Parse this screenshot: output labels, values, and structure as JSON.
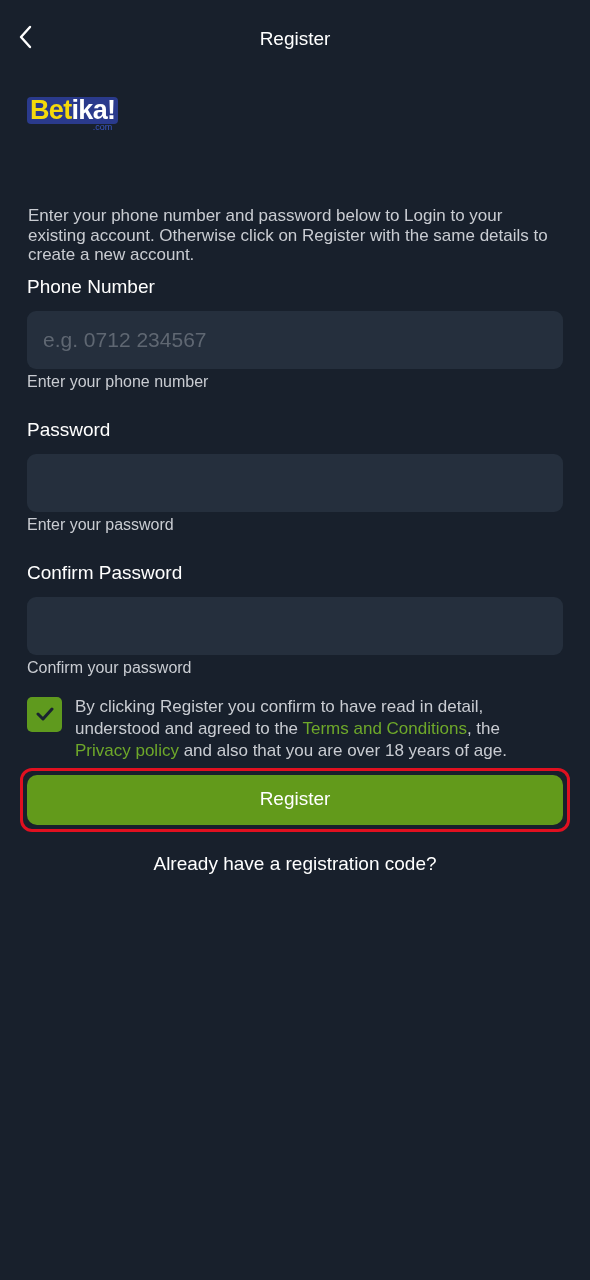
{
  "header": {
    "title": "Register"
  },
  "logo": {
    "name": "Betika",
    "mark": "!",
    "domain": ".com"
  },
  "intro": "Enter your phone number and password below to Login to your existing account. Otherwise click on Register with the same details to create a new account.",
  "fields": [
    {
      "label": "Phone Number",
      "placeholder": "e.g. 0712 234567",
      "hint": "Enter your phone number"
    },
    {
      "label": "Password",
      "hint": "Enter your password"
    },
    {
      "label": "Confirm Password",
      "hint": "Confirm your password"
    }
  ],
  "consent": {
    "checked": true,
    "parts": [
      {
        "kind": "text",
        "text": "By clicking Register you confirm to have read in detail, understood and agreed to the "
      },
      {
        "kind": "link",
        "text": "Terms and Conditions"
      },
      {
        "kind": "text",
        "text": ", the "
      },
      {
        "kind": "link",
        "text": "Privacy policy"
      },
      {
        "kind": "text",
        "text": " and also that you are over 18 years of age."
      }
    ]
  },
  "register_button": {
    "label": "Register",
    "highlighted": true
  },
  "code_link": "Already have a registration code?"
}
